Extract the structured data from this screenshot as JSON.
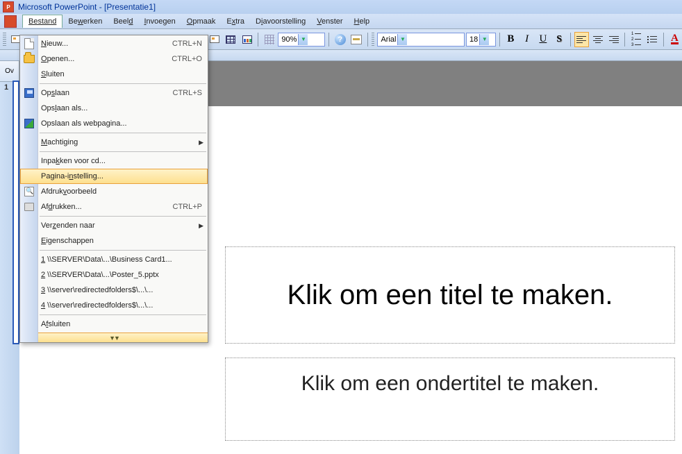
{
  "title_bar": {
    "app_name": "Microsoft PowerPoint - [Presentatie1]"
  },
  "menu_bar": {
    "items": [
      {
        "label": "Bestand",
        "hotkey_index": 0
      },
      {
        "label": "Bewerken",
        "hotkey_index": 2
      },
      {
        "label": "Beeld",
        "hotkey_index": 4
      },
      {
        "label": "Invoegen",
        "hotkey_index": 0
      },
      {
        "label": "Opmaak",
        "hotkey_index": 0
      },
      {
        "label": "Extra",
        "hotkey_index": 1
      },
      {
        "label": "Diavoorstelling",
        "hotkey_index": 1
      },
      {
        "label": "Venster",
        "hotkey_index": 0
      },
      {
        "label": "Help",
        "hotkey_index": 0
      }
    ]
  },
  "toolbar": {
    "zoom": "90%",
    "font": "Arial",
    "font_size": "18"
  },
  "outline_tab": "Ov",
  "slide_number": "1",
  "file_menu": {
    "items": [
      {
        "label": "Nieuw...",
        "ul": "N",
        "rest": "ieuw...",
        "shortcut": "CTRL+N",
        "icon": "new"
      },
      {
        "label": "Openen...",
        "ul": "O",
        "rest": "penen...",
        "shortcut": "CTRL+O",
        "icon": "open"
      },
      {
        "label": "Sluiten",
        "ul": "S",
        "rest": "luiten",
        "shortcut": "",
        "icon": ""
      },
      {
        "sep": true
      },
      {
        "label": "Opslaan",
        "ul": "",
        "rest": "Op",
        "mid_ul": "s",
        "tail": "laan",
        "shortcut": "CTRL+S",
        "icon": "save"
      },
      {
        "label": "Opslaan als...",
        "ul": "",
        "rest": "Ops",
        "mid_ul": "l",
        "tail": "aan als...",
        "shortcut": "",
        "icon": ""
      },
      {
        "label": "Opslaan als webpagina...",
        "ul": "",
        "rest": "Opslaan als webpa",
        "mid_ul": "g",
        "tail": "ina...",
        "shortcut": "",
        "icon": "saveweb"
      },
      {
        "sep": true
      },
      {
        "label": "Machtiging",
        "ul": "M",
        "rest": "achtiging",
        "shortcut": "",
        "icon": "",
        "submenu": true
      },
      {
        "sep": true
      },
      {
        "label": "Inpakken voor cd...",
        "ul": "",
        "rest": "Inpa",
        "mid_ul": "k",
        "tail": "ken voor cd...",
        "shortcut": "",
        "icon": ""
      },
      {
        "label": "Pagina-instelling...",
        "ul": "",
        "rest": "Pagina-i",
        "mid_ul": "n",
        "tail": "stelling...",
        "shortcut": "",
        "icon": "",
        "highlighted": true
      },
      {
        "label": "Afdrukvoorbeeld",
        "ul": "",
        "rest": "Afdruk",
        "mid_ul": "v",
        "tail": "oorbeeld",
        "shortcut": "",
        "icon": "preview"
      },
      {
        "label": "Afdrukken...",
        "ul": "",
        "rest": "Af",
        "mid_ul": "d",
        "tail": "rukken...",
        "shortcut": "CTRL+P",
        "icon": "print"
      },
      {
        "sep": true
      },
      {
        "label": "Verzenden naar",
        "ul": "",
        "rest": "Ver",
        "mid_ul": "z",
        "tail": "enden naar",
        "shortcut": "",
        "icon": "",
        "submenu": true
      },
      {
        "label": "Eigenschappen",
        "ul": "E",
        "rest": "igenschappen",
        "shortcut": "",
        "icon": ""
      },
      {
        "sep": true
      },
      {
        "label": "1 \\\\SERVER\\Data\\...\\Business Card1...",
        "ul": "1",
        "rest": " \\\\SERVER\\Data\\...\\Business Card1...",
        "shortcut": "",
        "icon": ""
      },
      {
        "label": "2 \\\\SERVER\\Data\\...\\Poster_5.pptx",
        "ul": "2",
        "rest": " \\\\SERVER\\Data\\...\\Poster_5.pptx",
        "shortcut": "",
        "icon": ""
      },
      {
        "label": "3 \\\\server\\redirectedfolders$\\...\\...",
        "ul": "3",
        "rest": " \\\\server\\redirectedfolders$\\...\\...",
        "shortcut": "",
        "icon": ""
      },
      {
        "label": "4 \\\\server\\redirectedfolders$\\...\\...",
        "ul": "4",
        "rest": " \\\\server\\redirectedfolders$\\...\\...",
        "shortcut": "",
        "icon": ""
      },
      {
        "sep": true
      },
      {
        "label": "Afsluiten",
        "ul": "",
        "rest": "A",
        "mid_ul": "f",
        "tail": "sluiten",
        "shortcut": "",
        "icon": ""
      }
    ]
  },
  "slide": {
    "title_placeholder": "Klik om een titel te maken.",
    "subtitle_placeholder": "Klik om een ondertitel te maken."
  }
}
